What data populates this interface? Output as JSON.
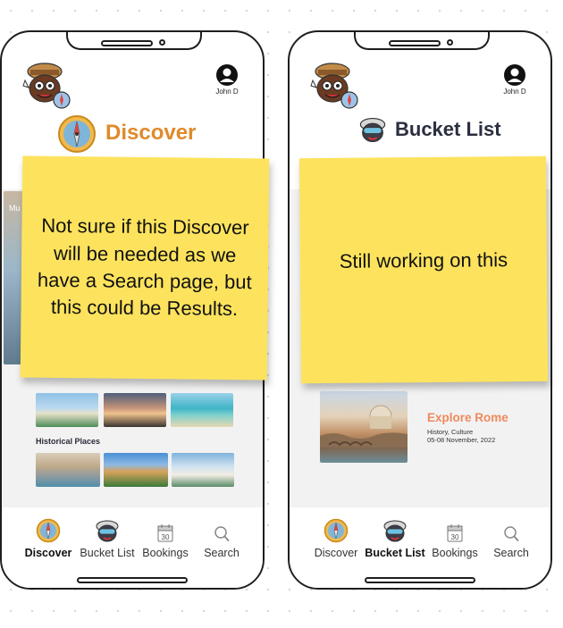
{
  "left_screen": {
    "profile_name": "John D",
    "title": "Discover",
    "side_peek_text": "Mu",
    "section_label": "Historical Places",
    "sticky_note": "Not sure if this Discover will be needed as we have a Search page, but this could be Results."
  },
  "right_screen": {
    "profile_name": "John D",
    "title": "Bucket List",
    "card": {
      "title": "Explore Rome",
      "tags": "History, Culture",
      "dates": "05-08 November, 2022"
    },
    "sticky_note": "Still working on this"
  },
  "nav": {
    "items": [
      {
        "label": "Discover",
        "icon": "compass-icon"
      },
      {
        "label": "Bucket List",
        "icon": "mascot-icon"
      },
      {
        "label": "Bookings",
        "icon": "calendar-icon"
      },
      {
        "label": "Search",
        "icon": "search-icon"
      }
    ],
    "calendar_day": "30"
  },
  "colors": {
    "accent_orange": "#e08a2c",
    "card_title": "#ef8a5c",
    "sticky_yellow": "#fde35d",
    "title_dark": "#2b2f3f"
  }
}
